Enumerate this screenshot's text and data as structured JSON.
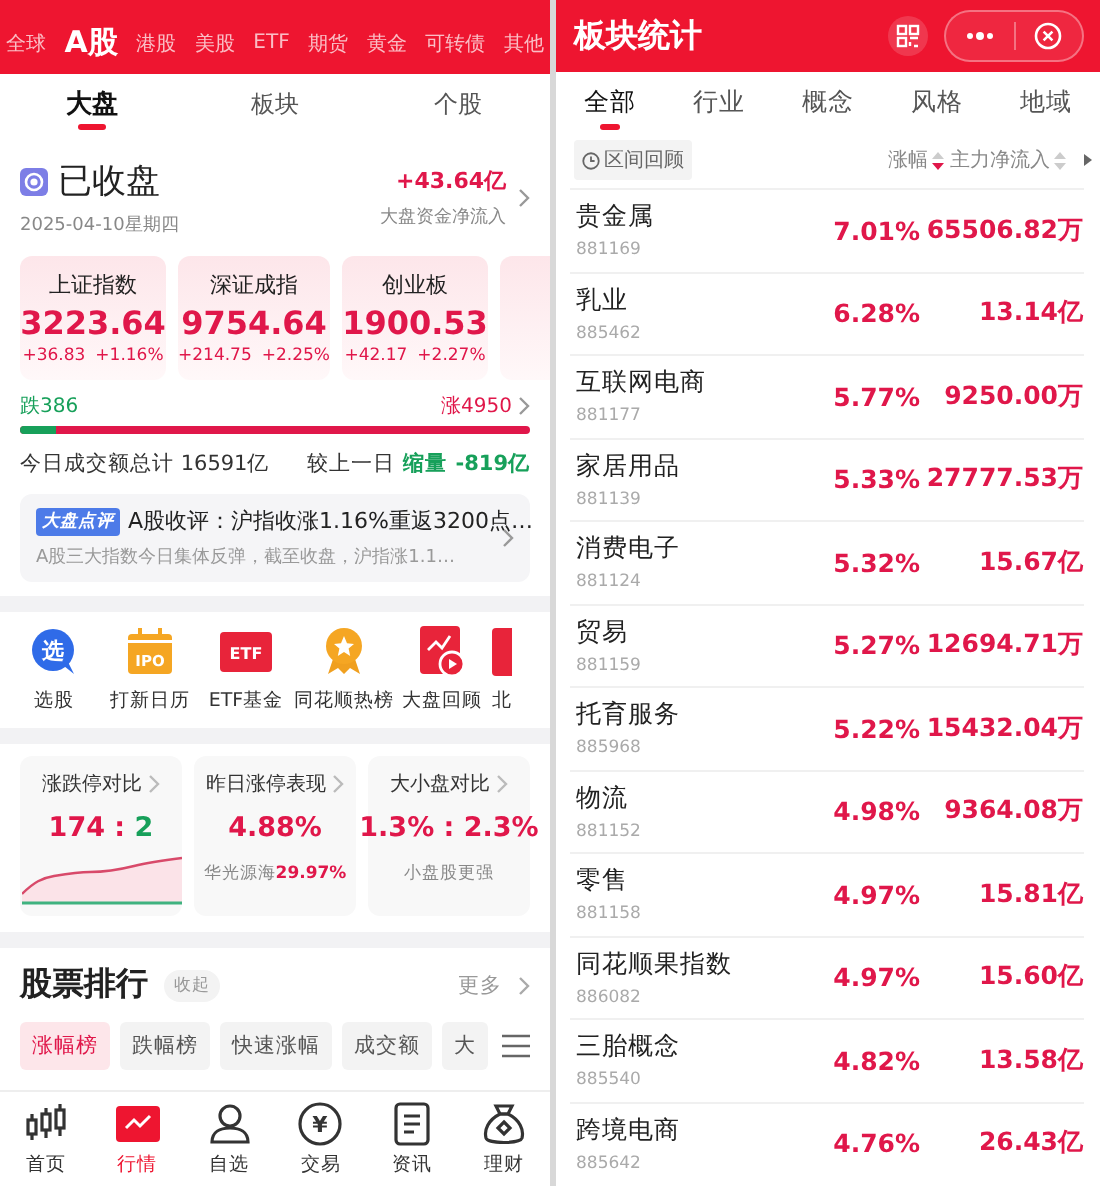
{
  "left": {
    "market_tabs": [
      {
        "label": "全球",
        "selected": false
      },
      {
        "label": "A股",
        "selected": true
      },
      {
        "label": "港股",
        "selected": false
      },
      {
        "label": "美股",
        "selected": false
      },
      {
        "label": "ETF",
        "selected": false
      },
      {
        "label": "期货",
        "selected": false
      },
      {
        "label": "黄金",
        "selected": false
      },
      {
        "label": "可转债",
        "selected": false
      },
      {
        "label": "其他",
        "selected": false
      }
    ],
    "sub_tabs": [
      {
        "label": "大盘",
        "selected": true
      },
      {
        "label": "板块",
        "selected": false
      },
      {
        "label": "个股",
        "selected": false
      }
    ],
    "status": {
      "title": "已收盘",
      "date": "2025-04-10星期四",
      "flow_value": "+43.64亿",
      "flow_label": "大盘资金净流入"
    },
    "indices": [
      {
        "name": "上证指数",
        "value": "3223.64",
        "change": "+36.83",
        "percent": "+1.16%"
      },
      {
        "name": "深证成指",
        "value": "9754.64",
        "change": "+214.75",
        "percent": "+2.25%"
      },
      {
        "name": "创业板",
        "value": "1900.53",
        "change": "+42.17",
        "percent": "+2.27%"
      }
    ],
    "breadth": {
      "down": "跌386",
      "up": "涨4950",
      "level": 0.07
    },
    "turnover": {
      "label": "今日成交额总计 16591亿",
      "compare_label": "较上一日",
      "compare_tag": "缩量",
      "compare_value": "-819亿"
    },
    "news": {
      "badge": "大盘点评",
      "title": "A股收评：沪指收涨1.16%重返3200点…",
      "summary": "A股三大指数今日集体反弹，截至收盘，沪指涨1.1…"
    },
    "shortcuts": [
      {
        "label": "选股",
        "icon_text": "选"
      },
      {
        "label": "打新日历",
        "icon_text": "IPO"
      },
      {
        "label": "ETF基金",
        "icon_text": "ETF"
      },
      {
        "label": "同花顺热榜"
      },
      {
        "label": "大盘回顾"
      },
      {
        "label": "北"
      }
    ],
    "stat_cards": [
      {
        "kind": "sparkline",
        "title": "涨跌停对比",
        "value": [
          {
            "text": "174",
            "rising": true
          },
          {
            "text": " : ",
            "rising": true
          },
          {
            "text": "2",
            "rising": false
          }
        ]
      },
      {
        "kind": "note",
        "title": "昨日涨停表现",
        "value": [
          {
            "text": "4.88%",
            "rising": true
          }
        ],
        "note": "华光源海",
        "note_value": "29.97%"
      },
      {
        "kind": "note",
        "title": "大小盘对比",
        "value": [
          {
            "text": "1.3% : 2.3%",
            "rising": true
          }
        ],
        "note": "小盘股更强"
      }
    ],
    "ranking": {
      "title": "股票排行",
      "collapse": "收起",
      "more": "更多",
      "chips": [
        {
          "label": "涨幅榜",
          "selected": true
        },
        {
          "label": "跌幅榜",
          "selected": false
        },
        {
          "label": "快速涨幅",
          "selected": false
        },
        {
          "label": "成交额",
          "selected": false
        },
        {
          "label": "大",
          "selected": false
        }
      ]
    },
    "nav": [
      {
        "label": "首页",
        "selected": false
      },
      {
        "label": "行情",
        "selected": true
      },
      {
        "label": "自选",
        "selected": false
      },
      {
        "label": "交易",
        "selected": false,
        "icon_text": "¥"
      },
      {
        "label": "资讯",
        "selected": false
      },
      {
        "label": "理财",
        "selected": false
      }
    ]
  },
  "right": {
    "title": "板块统计",
    "tabs": [
      {
        "label": "全部",
        "selected": true
      },
      {
        "label": "行业",
        "selected": false
      },
      {
        "label": "概念",
        "selected": false
      },
      {
        "label": "风格",
        "selected": false
      },
      {
        "label": "地域",
        "selected": false
      }
    ],
    "review_button": "区间回顾",
    "columns": [
      {
        "label": "涨幅",
        "sorted_desc": true
      },
      {
        "label": "主力净流入",
        "sorted_desc": false
      }
    ],
    "rows": [
      {
        "name": "贵金属",
        "code": "881169",
        "change": "7.01%",
        "inflow": "65506.82万"
      },
      {
        "name": "乳业",
        "code": "885462",
        "change": "6.28%",
        "inflow": "13.14亿"
      },
      {
        "name": "互联网电商",
        "code": "881177",
        "change": "5.77%",
        "inflow": "9250.00万"
      },
      {
        "name": "家居用品",
        "code": "881139",
        "change": "5.33%",
        "inflow": "27777.53万"
      },
      {
        "name": "消费电子",
        "code": "881124",
        "change": "5.32%",
        "inflow": "15.67亿"
      },
      {
        "name": "贸易",
        "code": "881159",
        "change": "5.27%",
        "inflow": "12694.71万"
      },
      {
        "name": "托育服务",
        "code": "885968",
        "change": "5.22%",
        "inflow": "15432.04万"
      },
      {
        "name": "物流",
        "code": "881152",
        "change": "4.98%",
        "inflow": "9364.08万"
      },
      {
        "name": "零售",
        "code": "881158",
        "change": "4.97%",
        "inflow": "15.81亿"
      },
      {
        "name": "同花顺果指数",
        "code": "886082",
        "change": "4.97%",
        "inflow": "15.60亿"
      },
      {
        "name": "三胎概念",
        "code": "885540",
        "change": "4.82%",
        "inflow": "13.58亿"
      },
      {
        "name": "跨境电商",
        "code": "885642",
        "change": "4.76%",
        "inflow": "26.43亿"
      }
    ]
  }
}
